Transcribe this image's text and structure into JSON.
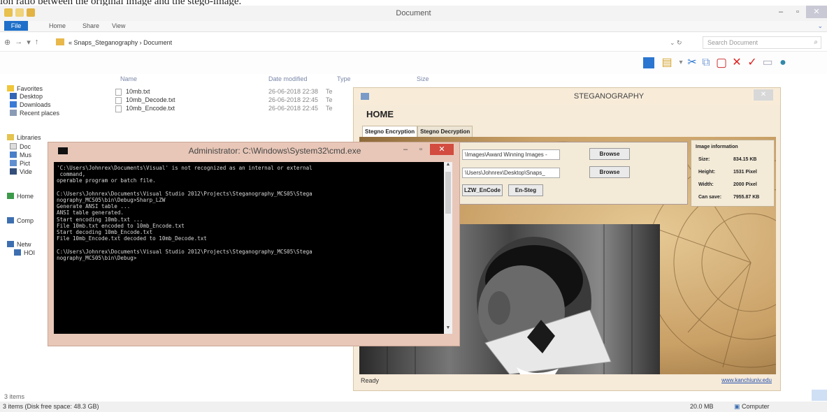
{
  "caption": "ion ratio between the original image and the stego-image.",
  "explorer": {
    "title": "Document",
    "ribbon_tabs": [
      "File",
      "Home",
      "Share",
      "View"
    ],
    "address": "« Snaps_Steganography › Document",
    "search_placeholder": "Search Document",
    "nav": {
      "favorites": "Favorites",
      "desktop": "Desktop",
      "downloads": "Downloads",
      "recent": "Recent places",
      "libraries": "Libraries",
      "docs": "Doc",
      "music": "Mus",
      "pictures": "Pict",
      "videos": "Vide",
      "homegroup": "Home",
      "computer": "Comp",
      "network": "Netw",
      "host": "HOI"
    },
    "columns": {
      "name": "Name",
      "date": "Date modified",
      "type": "Type",
      "size": "Size"
    },
    "files": [
      {
        "name": "10mb.txt",
        "date": "26-06-2018 22:38",
        "type": "Te"
      },
      {
        "name": "10mb_Decode.txt",
        "date": "26-06-2018 22:45",
        "type": "Te"
      },
      {
        "name": "10mb_Encode.txt",
        "date": "26-06-2018 22:45",
        "type": "Te"
      }
    ],
    "item_count": "3 items",
    "status_left": "3 items (Disk free space: 48.3 GB)",
    "status_size": "20.0 MB",
    "status_computer": "Computer"
  },
  "steg": {
    "title": "STEGANOGRAPHY",
    "home": "HOME",
    "tabs": [
      "Stegno Encryption",
      "Stegno Decryption"
    ],
    "input1": "\\Images\\Award Winning Images -",
    "input2": "\\Users\\Johnrex\\Desktop\\Snaps_",
    "browse1": "Browse",
    "browse2": "Browse",
    "encode_btn": "LZW_EnCode",
    "ensteg_btn": "En-Steg",
    "info": {
      "header": "Image information",
      "size_label": "Size:",
      "size_value": "834.15 KB",
      "height_label": "Height:",
      "height_value": "1531 Pixel",
      "width_label": "Width:",
      "width_value": "2000 Pixel",
      "cansave_label": "Can save:",
      "cansave_value": "7955.87 KB"
    },
    "status": "Ready",
    "link": "www.kanchiuniv.edu"
  },
  "cmd": {
    "title": "Administrator: C:\\Windows\\System32\\cmd.exe",
    "lines": [
      "'C:\\Users\\Johnrex\\Documents\\Visual' is not recognized as an internal or external",
      " command,",
      "operable program or batch file.",
      "",
      "C:\\Users\\Johnrex\\Documents\\Visual Studio 2012\\Projects\\Steganography_MCS05\\Stega",
      "nography_MCS05\\bin\\Debug>Sharp_LZW",
      "Generate ANSI table ...",
      "ANSI table generated.",
      "Start encoding 10mb.txt ...",
      "File 10mb.txt encoded to 10mb_Encode.txt",
      "Start decoding 10mb_Encode.txt",
      "File 10mb_Encode.txt decoded to 10mb_Decode.txt",
      "",
      "C:\\Users\\Johnrex\\Documents\\Visual Studio 2012\\Projects\\Steganography_MCS05\\Stega",
      "nography_MCS05\\bin\\Debug>"
    ]
  }
}
